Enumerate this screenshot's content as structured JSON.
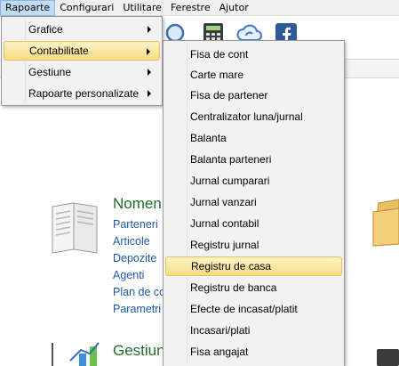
{
  "menubar": {
    "items": [
      {
        "label": "Rapoarte"
      },
      {
        "label": "Configurari"
      },
      {
        "label": "Utilitare"
      },
      {
        "label": "Ferestre"
      },
      {
        "label": "Ajutor"
      }
    ]
  },
  "dashboard": {
    "section1": {
      "title": "Nomen",
      "links": [
        "Parteneri",
        "Articole",
        "Depozite",
        "Agenti",
        "Plan de co",
        "Parametri"
      ]
    },
    "section2": {
      "title": "Gestiun"
    }
  },
  "rapoarte_menu": {
    "items": [
      {
        "label": "Grafice"
      },
      {
        "label": "Contabilitate"
      },
      {
        "label": "Gestiune"
      },
      {
        "label": "Rapoarte personalizate"
      }
    ]
  },
  "contabilitate_menu": {
    "items": [
      {
        "label": "Fisa de cont"
      },
      {
        "label": "Carte mare"
      },
      {
        "label": "Fisa de partener"
      },
      {
        "label": "Centralizator luna/jurnal"
      },
      {
        "label": "Balanta"
      },
      {
        "label": "Balanta parteneri"
      },
      {
        "label": "Jurnal cumparari"
      },
      {
        "label": "Jurnal vanzari"
      },
      {
        "label": "Jurnal contabil"
      },
      {
        "label": "Registru jurnal"
      },
      {
        "label": "Registru de casa"
      },
      {
        "label": "Registru de banca"
      },
      {
        "label": "Efecte de incasat/platit"
      },
      {
        "label": "Incasari/plati"
      },
      {
        "label": "Fisa angajat"
      }
    ]
  }
}
